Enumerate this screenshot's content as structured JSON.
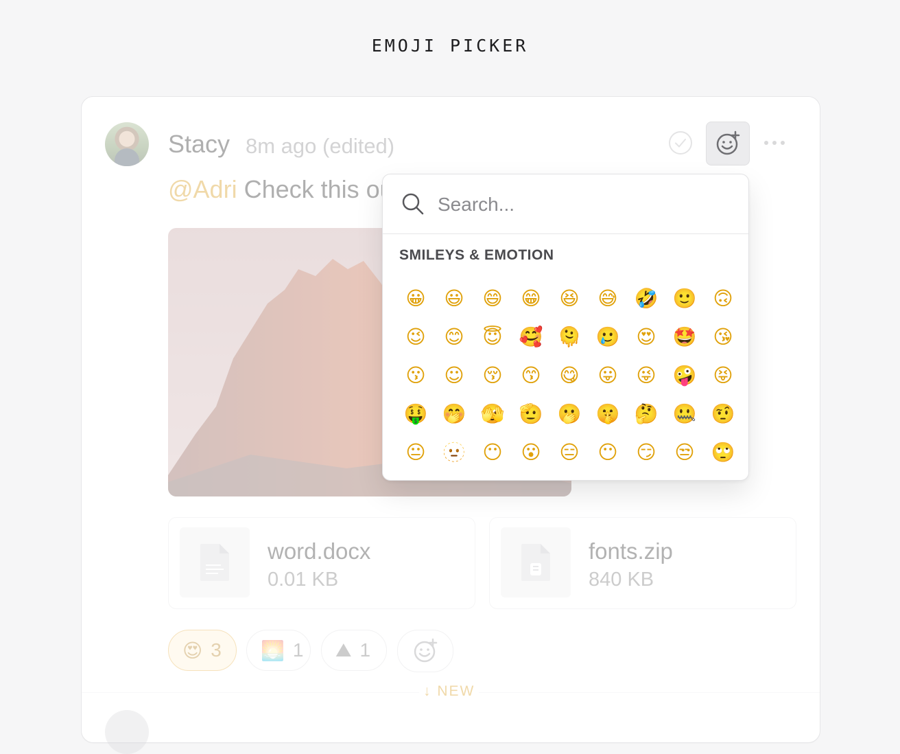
{
  "page": {
    "title": "EMOJI PICKER"
  },
  "message": {
    "author": "Stacy",
    "time": "8m ago (edited)",
    "mention": "@Adri",
    "text": "Check this out"
  },
  "attachments": [
    {
      "name": "word.docx",
      "size": "0.01 KB",
      "icon": "document-icon"
    },
    {
      "name": "fonts.zip",
      "size": "840 KB",
      "icon": "archive-icon"
    }
  ],
  "reactions": [
    {
      "emoji": "😍",
      "count": "3",
      "active": true
    },
    {
      "emoji": "🌅",
      "count": "1",
      "active": false
    },
    {
      "emoji": "⛰",
      "count": "1",
      "active": false
    }
  ],
  "divider": {
    "label": "↓ NEW"
  },
  "picker": {
    "search_placeholder": "Search...",
    "section_title": "SMILEYS & EMOTION",
    "emojis": [
      "😀",
      "😃",
      "😄",
      "😁",
      "😆",
      "😅",
      "🤣",
      "🙂",
      "🙃",
      "😉",
      "😊",
      "😇",
      "🥰",
      "🫠",
      "🥲",
      "😍",
      "🤩",
      "😘",
      "😗",
      "☺",
      "😚",
      "😙",
      "😋",
      "😛",
      "😜",
      "🤪",
      "😝",
      "🤑",
      "🤭",
      "🫣",
      "🫡",
      "🫢",
      "🤫",
      "🤔",
      "🤐",
      "🤨",
      "😐",
      "🫥",
      "😶",
      "😮",
      "😑",
      "😶",
      "😏",
      "😒",
      "🙄"
    ]
  },
  "colors": {
    "accent": "#d89a1c",
    "reaction_active_bg": "#fff2d6"
  }
}
